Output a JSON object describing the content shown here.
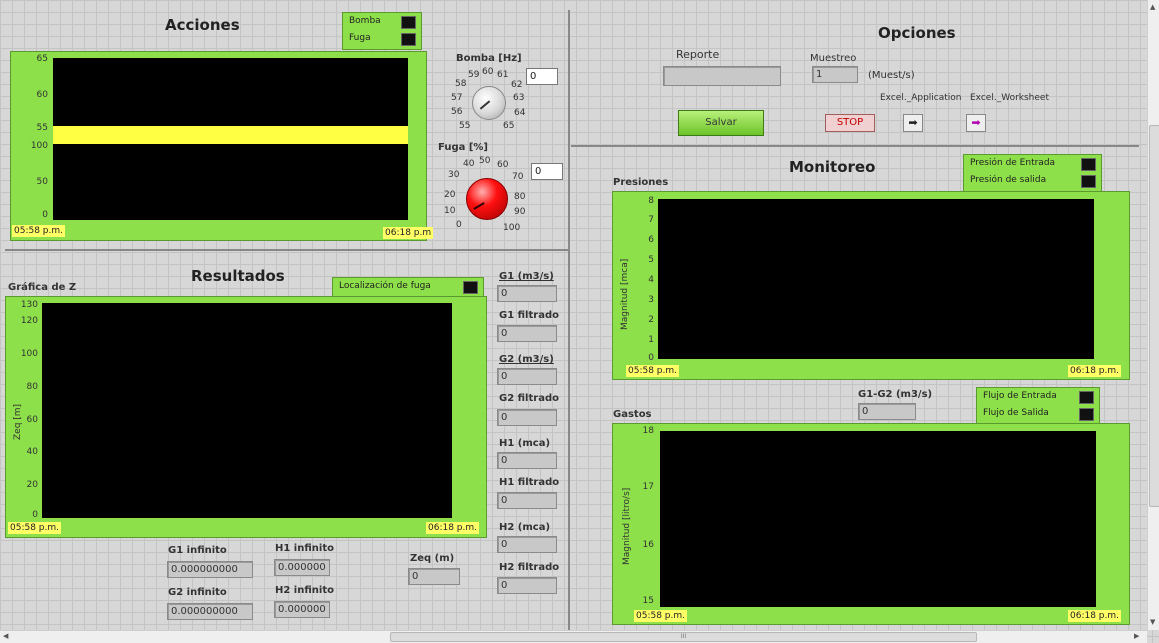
{
  "acciones": {
    "title": "Acciones",
    "legend": [
      "Bomba",
      "Fuga"
    ],
    "yticks": [
      "65",
      "60",
      "55",
      "100",
      "50",
      "0"
    ],
    "time_start": "05:58 p.m.",
    "time_end": "06:18 p.m",
    "bomba_label": "Bomba [Hz]",
    "bomba_value": "0",
    "bomba_scale": [
      "58",
      "59",
      "60",
      "61",
      "62",
      "57",
      "63",
      "56",
      "64",
      "55",
      "65"
    ],
    "fuga_label": "Fuga [%]",
    "fuga_value": "0",
    "fuga_scale": [
      "40",
      "50",
      "60",
      "30",
      "70",
      "20",
      "80",
      "10",
      "90",
      "0",
      "100"
    ]
  },
  "resultados": {
    "title": "Resultados",
    "graph_title": "Gráfica de Z",
    "legend": "Localización de fuga",
    "ylabel": "Zeq [m]",
    "yticks": [
      "130",
      "120",
      "100",
      "80",
      "60",
      "40",
      "20",
      "0"
    ],
    "time_start": "05:58 p.m.",
    "time_end": "06:18 p.m.",
    "indicators": [
      {
        "label": "G1 (m3/s)",
        "value": "0"
      },
      {
        "label": "G1 filtrado",
        "value": "0"
      },
      {
        "label": "G2 (m3/s)",
        "value": "0"
      },
      {
        "label": "G2 filtrado",
        "value": "0"
      },
      {
        "label": "H1 (mca)",
        "value": "0"
      },
      {
        "label": "H1 filtrado",
        "value": "0"
      },
      {
        "label": "H2 (mca)",
        "value": "0"
      },
      {
        "label": "H2 filtrado",
        "value": "0"
      }
    ],
    "g1_inf_label": "G1 infinito",
    "g1_inf_value": "0.000000000",
    "g2_inf_label": "G2 infinito",
    "g2_inf_value": "0.000000000",
    "h1_inf_label": "H1 infinito",
    "h1_inf_value": "0.000000",
    "h2_inf_label": "H2 infinito",
    "h2_inf_value": "0.000000",
    "zeq_label": "Zeq (m)",
    "zeq_value": "0"
  },
  "opciones": {
    "title": "Opciones",
    "reporte_label": "Reporte",
    "reporte_value": "",
    "muestreo_label": "Muestreo",
    "muestreo_value": "1",
    "muestreo_unit": "(Muest/s)",
    "excel_app_label": "Excel._Application",
    "excel_ws_label": "Excel._Worksheet",
    "salvar_label": "Salvar",
    "stop_label": "STOP"
  },
  "monitoreo": {
    "title": "Monitoreo",
    "presiones": {
      "title": "Presiones",
      "legend": [
        "Presión de Entrada",
        "Presión de salida"
      ],
      "ylabel": "Magnitud [mca]",
      "yticks": [
        "8",
        "7",
        "6",
        "5",
        "4",
        "3",
        "2",
        "1",
        "0"
      ],
      "time_start": "05:58 p.m.",
      "time_end": "06:18 p.m."
    },
    "g1g2_label": "G1-G2 (m3/s)",
    "g1g2_value": "0",
    "gastos": {
      "title": "Gastos",
      "legend": [
        "Flujo de Entrada",
        "Flujo de Salida"
      ],
      "ylabel": "Magnitud [litro/s]",
      "yticks": [
        "18",
        "17",
        "16",
        "15"
      ],
      "time_start": "05:58 p.m.",
      "time_end": "06:18 p.m."
    }
  },
  "scrollbar": {
    "h_label": "III"
  }
}
